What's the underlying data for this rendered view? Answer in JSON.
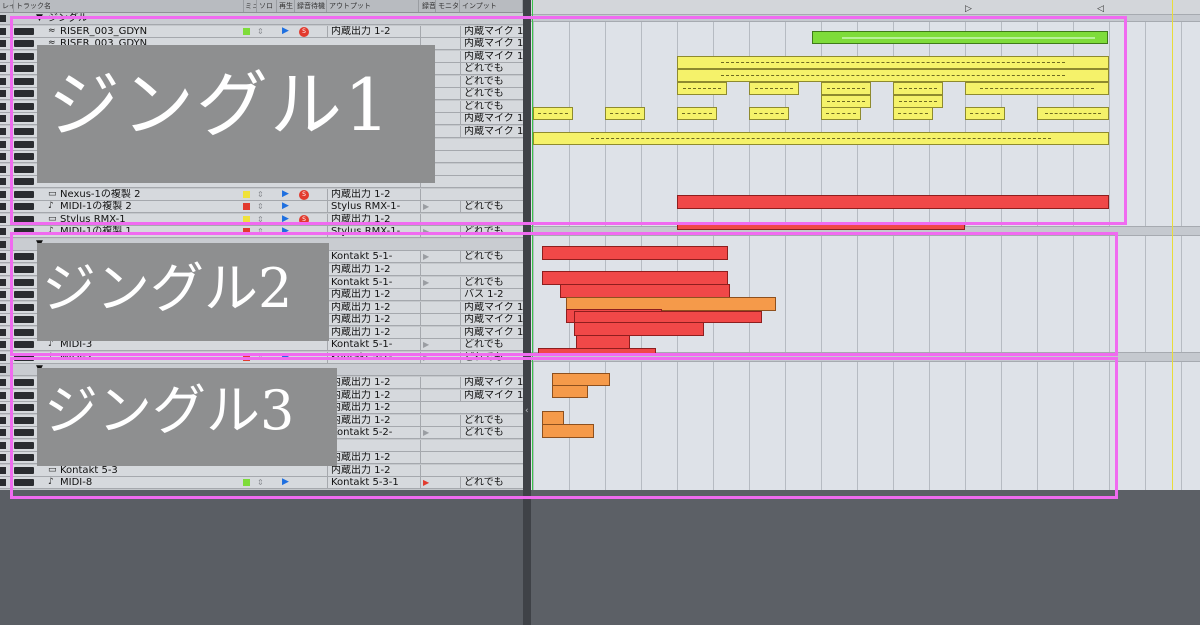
{
  "header": {
    "cols": [
      "レイヤ",
      "トラック名",
      "ミュート",
      "ソロ",
      "再生",
      "録音待機",
      "アウトプット",
      "録音",
      "モニタ",
      "インプット"
    ]
  },
  "tracks": [
    {
      "name": "ジングル",
      "kind": "folder",
      "color": "",
      "output": "",
      "input": ""
    },
    {
      "name": "RISER_003_GDYN",
      "kind": "audio",
      "color": "#7edc3a",
      "output": "内蔵出力 1-2",
      "input": "内蔵マイク 1-"
    },
    {
      "name": "RISER_003_GDYN",
      "kind": "audio",
      "color": "",
      "output": "",
      "input": "内蔵マイク 1-"
    },
    {
      "name": "",
      "kind": "audio",
      "color": "",
      "output": "",
      "input": "内蔵マイク 1-"
    },
    {
      "name": "",
      "kind": "midi",
      "color": "",
      "output": "",
      "input": "どれでも"
    },
    {
      "name": "",
      "kind": "midi",
      "color": "",
      "output": "",
      "input": "どれでも"
    },
    {
      "name": "",
      "kind": "midi",
      "color": "",
      "output": "",
      "input": "どれでも"
    },
    {
      "name": "",
      "kind": "midi",
      "color": "",
      "output": "",
      "input": "どれでも"
    },
    {
      "name": "",
      "kind": "audio",
      "color": "",
      "output": "",
      "input": "内蔵マイク 1-"
    },
    {
      "name": "",
      "kind": "audio",
      "color": "",
      "output": "",
      "input": "内蔵マイク 1-"
    },
    {
      "name": "",
      "kind": "audio",
      "color": "",
      "output": "",
      "input": ""
    },
    {
      "name": "",
      "kind": "audio",
      "color": "",
      "output": "",
      "input": ""
    },
    {
      "name": "",
      "kind": "audio",
      "color": "",
      "output": "",
      "input": ""
    },
    {
      "name": "",
      "kind": "audio",
      "color": "",
      "output": "",
      "input": ""
    },
    {
      "name": "Nexus-1の複製 2",
      "kind": "inst",
      "color": "#f0e23a",
      "output": "内蔵出力 1-2",
      "input": ""
    },
    {
      "name": "MIDI-1の複製 2",
      "kind": "midi",
      "color": "#e23a2e",
      "output": "Stylus RMX-1-",
      "input": "どれでも"
    },
    {
      "name": "Stylus RMX-1",
      "kind": "inst",
      "color": "#f0e23a",
      "output": "内蔵出力 1-2",
      "input": ""
    },
    {
      "name": "MIDI-1の複製 1",
      "kind": "midi",
      "color": "#e23a2e",
      "output": "Stylus RMX-1-",
      "input": "どれでも"
    },
    {
      "name": "",
      "kind": "folder",
      "color": "",
      "output": "",
      "input": ""
    },
    {
      "name": "",
      "kind": "midi",
      "color": "",
      "output": "Kontakt 5-1-",
      "input": "どれでも"
    },
    {
      "name": "",
      "kind": "audio",
      "color": "",
      "output": "内蔵出力 1-2",
      "input": ""
    },
    {
      "name": "",
      "kind": "midi",
      "color": "",
      "output": "Kontakt 5-1-",
      "input": "どれでも"
    },
    {
      "name": "",
      "kind": "audio",
      "color": "",
      "output": "内蔵出力 1-2",
      "input": "バス 1-2"
    },
    {
      "name": "",
      "kind": "audio",
      "color": "",
      "output": "内蔵出力 1-2",
      "input": "内蔵マイク 1-"
    },
    {
      "name": "",
      "kind": "audio",
      "color": "",
      "output": "内蔵出力 1-2",
      "input": "内蔵マイク 1-"
    },
    {
      "name": "",
      "kind": "audio",
      "color": "",
      "output": "内蔵出力 1-2",
      "input": "内蔵マイク 1-"
    },
    {
      "name": "MIDI-3",
      "kind": "midi",
      "color": "",
      "output": "Kontakt 5-1-",
      "input": "どれでも"
    },
    {
      "name": "MIDI-2",
      "kind": "midi",
      "color": "#e23a2e",
      "output": "Kontakt 5-1-",
      "input": "どれでも"
    },
    {
      "name": "",
      "kind": "folder",
      "color": "",
      "output": "",
      "input": ""
    },
    {
      "name": "",
      "kind": "audio",
      "color": "",
      "output": "内蔵出力 1-2",
      "input": "内蔵マイク 1-"
    },
    {
      "name": "",
      "kind": "audio",
      "color": "",
      "output": "内蔵出力 1-2",
      "input": "内蔵マイク 1-"
    },
    {
      "name": "",
      "kind": "audio",
      "color": "",
      "output": "内蔵出力 1-2",
      "input": ""
    },
    {
      "name": "",
      "kind": "audio",
      "color": "",
      "output": "内蔵出力 1-2",
      "input": "どれでも"
    },
    {
      "name": "",
      "kind": "midi",
      "color": "",
      "output": "Kontakt 5-2-",
      "input": "どれでも"
    },
    {
      "name": "",
      "kind": "audio",
      "color": "",
      "output": "",
      "input": ""
    },
    {
      "name": "",
      "kind": "audio",
      "color": "",
      "output": "内蔵出力 1-2",
      "input": ""
    },
    {
      "name": "Kontakt 5-3",
      "kind": "inst",
      "color": "",
      "output": "内蔵出力 1-2",
      "input": ""
    },
    {
      "name": "MIDI-8",
      "kind": "midi",
      "color": "#7edc3a",
      "output": "Kontakt 5-3-1",
      "input": "どれでも"
    }
  ],
  "overlays": [
    {
      "text": "ジングル1"
    },
    {
      "text": "ジングル2"
    },
    {
      "text": "ジングル3"
    }
  ]
}
